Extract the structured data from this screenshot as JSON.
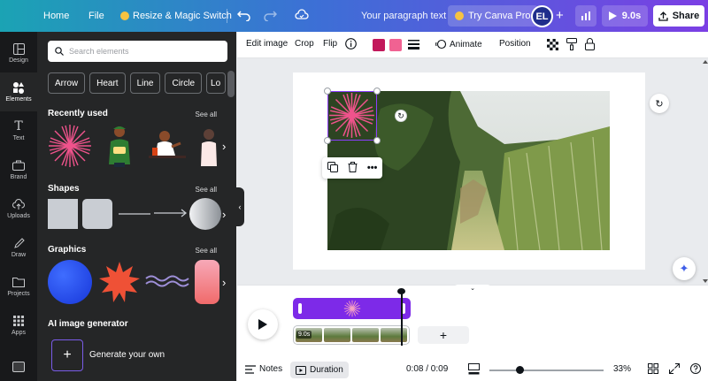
{
  "topbar": {
    "home": "Home",
    "file": "File",
    "resize": "Resize & Magic Switch",
    "doc_title": "Your paragraph text",
    "try_pro": "Try Canva Pro",
    "avatar_initials": "EL",
    "play_duration": "9.0s",
    "share": "Share"
  },
  "rail": {
    "items": [
      {
        "label": "Design",
        "icon": "layout-icon"
      },
      {
        "label": "Elements",
        "icon": "elements-icon"
      },
      {
        "label": "Text",
        "icon": "text-icon"
      },
      {
        "label": "Brand",
        "icon": "brand-icon"
      },
      {
        "label": "Uploads",
        "icon": "upload-icon"
      },
      {
        "label": "Draw",
        "icon": "draw-icon"
      },
      {
        "label": "Projects",
        "icon": "folder-icon"
      },
      {
        "label": "Apps",
        "icon": "apps-icon"
      }
    ]
  },
  "panel": {
    "search_placeholder": "Search elements",
    "chips": [
      "Arrow",
      "Heart",
      "Line",
      "Circle",
      "Lo"
    ],
    "recently_used": "Recently used",
    "shapes": "Shapes",
    "graphics": "Graphics",
    "ai_generator": "AI image generator",
    "generate": "Generate your own",
    "see_all": "See all"
  },
  "context_toolbar": {
    "edit_image": "Edit image",
    "crop": "Crop",
    "flip": "Flip",
    "animate": "Animate",
    "position": "Position",
    "colors": [
      "#c2185b",
      "#f06292"
    ]
  },
  "timeline": {
    "clip_duration": "9.0s"
  },
  "bottombar": {
    "notes": "Notes",
    "duration": "Duration",
    "time": "0:08 / 0:09",
    "zoom": "33%",
    "zoom_level": 0.27
  },
  "colors": {
    "accent": "#8b3dff",
    "panel_bg": "#252627",
    "rail_bg": "#18191b"
  }
}
